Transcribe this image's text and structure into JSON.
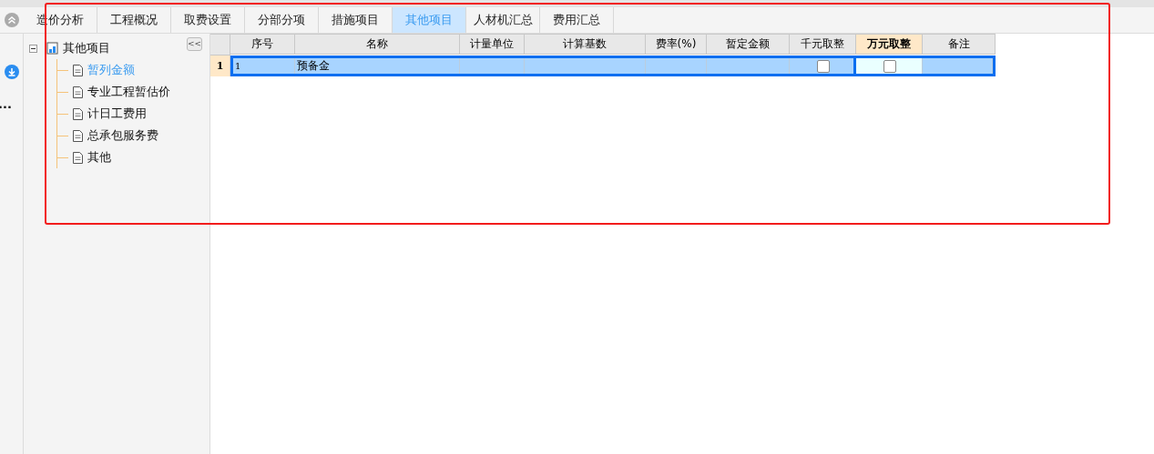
{
  "tabs": [
    {
      "label": "造价分析",
      "selected": false
    },
    {
      "label": "工程概况",
      "selected": false
    },
    {
      "label": "取费设置",
      "selected": false
    },
    {
      "label": "分部分项",
      "selected": false
    },
    {
      "label": "措施项目",
      "selected": false
    },
    {
      "label": "其他项目",
      "selected": true
    },
    {
      "label": "人材机汇总",
      "selected": false
    },
    {
      "label": "费用汇总",
      "selected": false
    }
  ],
  "left_strip": {
    "text": "..."
  },
  "tree": {
    "root": {
      "label": "其他项目",
      "expanded": true,
      "children": [
        {
          "label": "暂列金额",
          "selected": true
        },
        {
          "label": "专业工程暂估价",
          "selected": false
        },
        {
          "label": "计日工费用",
          "selected": false
        },
        {
          "label": "总承包服务费",
          "selected": false
        },
        {
          "label": "其他",
          "selected": false
        }
      ]
    },
    "collapse_button": "<<"
  },
  "table": {
    "columns": [
      {
        "label": "序号",
        "selected": false
      },
      {
        "label": "名称",
        "selected": false
      },
      {
        "label": "计量单位",
        "selected": false
      },
      {
        "label": "计算基数",
        "selected": false
      },
      {
        "label": "费率(%)",
        "selected": false
      },
      {
        "label": "暂定金额",
        "selected": false
      },
      {
        "label": "千元取整",
        "selected": false
      },
      {
        "label": "万元取整",
        "selected": true
      },
      {
        "label": "备注",
        "selected": false
      }
    ],
    "rows": [
      {
        "number": "1",
        "selected": true,
        "cells": [
          {
            "kind": "text",
            "text": "1"
          },
          {
            "kind": "text",
            "text": "预备金"
          },
          {
            "kind": "text",
            "text": ""
          },
          {
            "kind": "text",
            "text": ""
          },
          {
            "kind": "text",
            "text": ""
          },
          {
            "kind": "text",
            "text": ""
          },
          {
            "kind": "checkbox",
            "checked": false
          },
          {
            "kind": "checkbox",
            "checked": false
          },
          {
            "kind": "text",
            "text": ""
          }
        ]
      }
    ]
  },
  "annotation": {
    "kind": "frame"
  }
}
